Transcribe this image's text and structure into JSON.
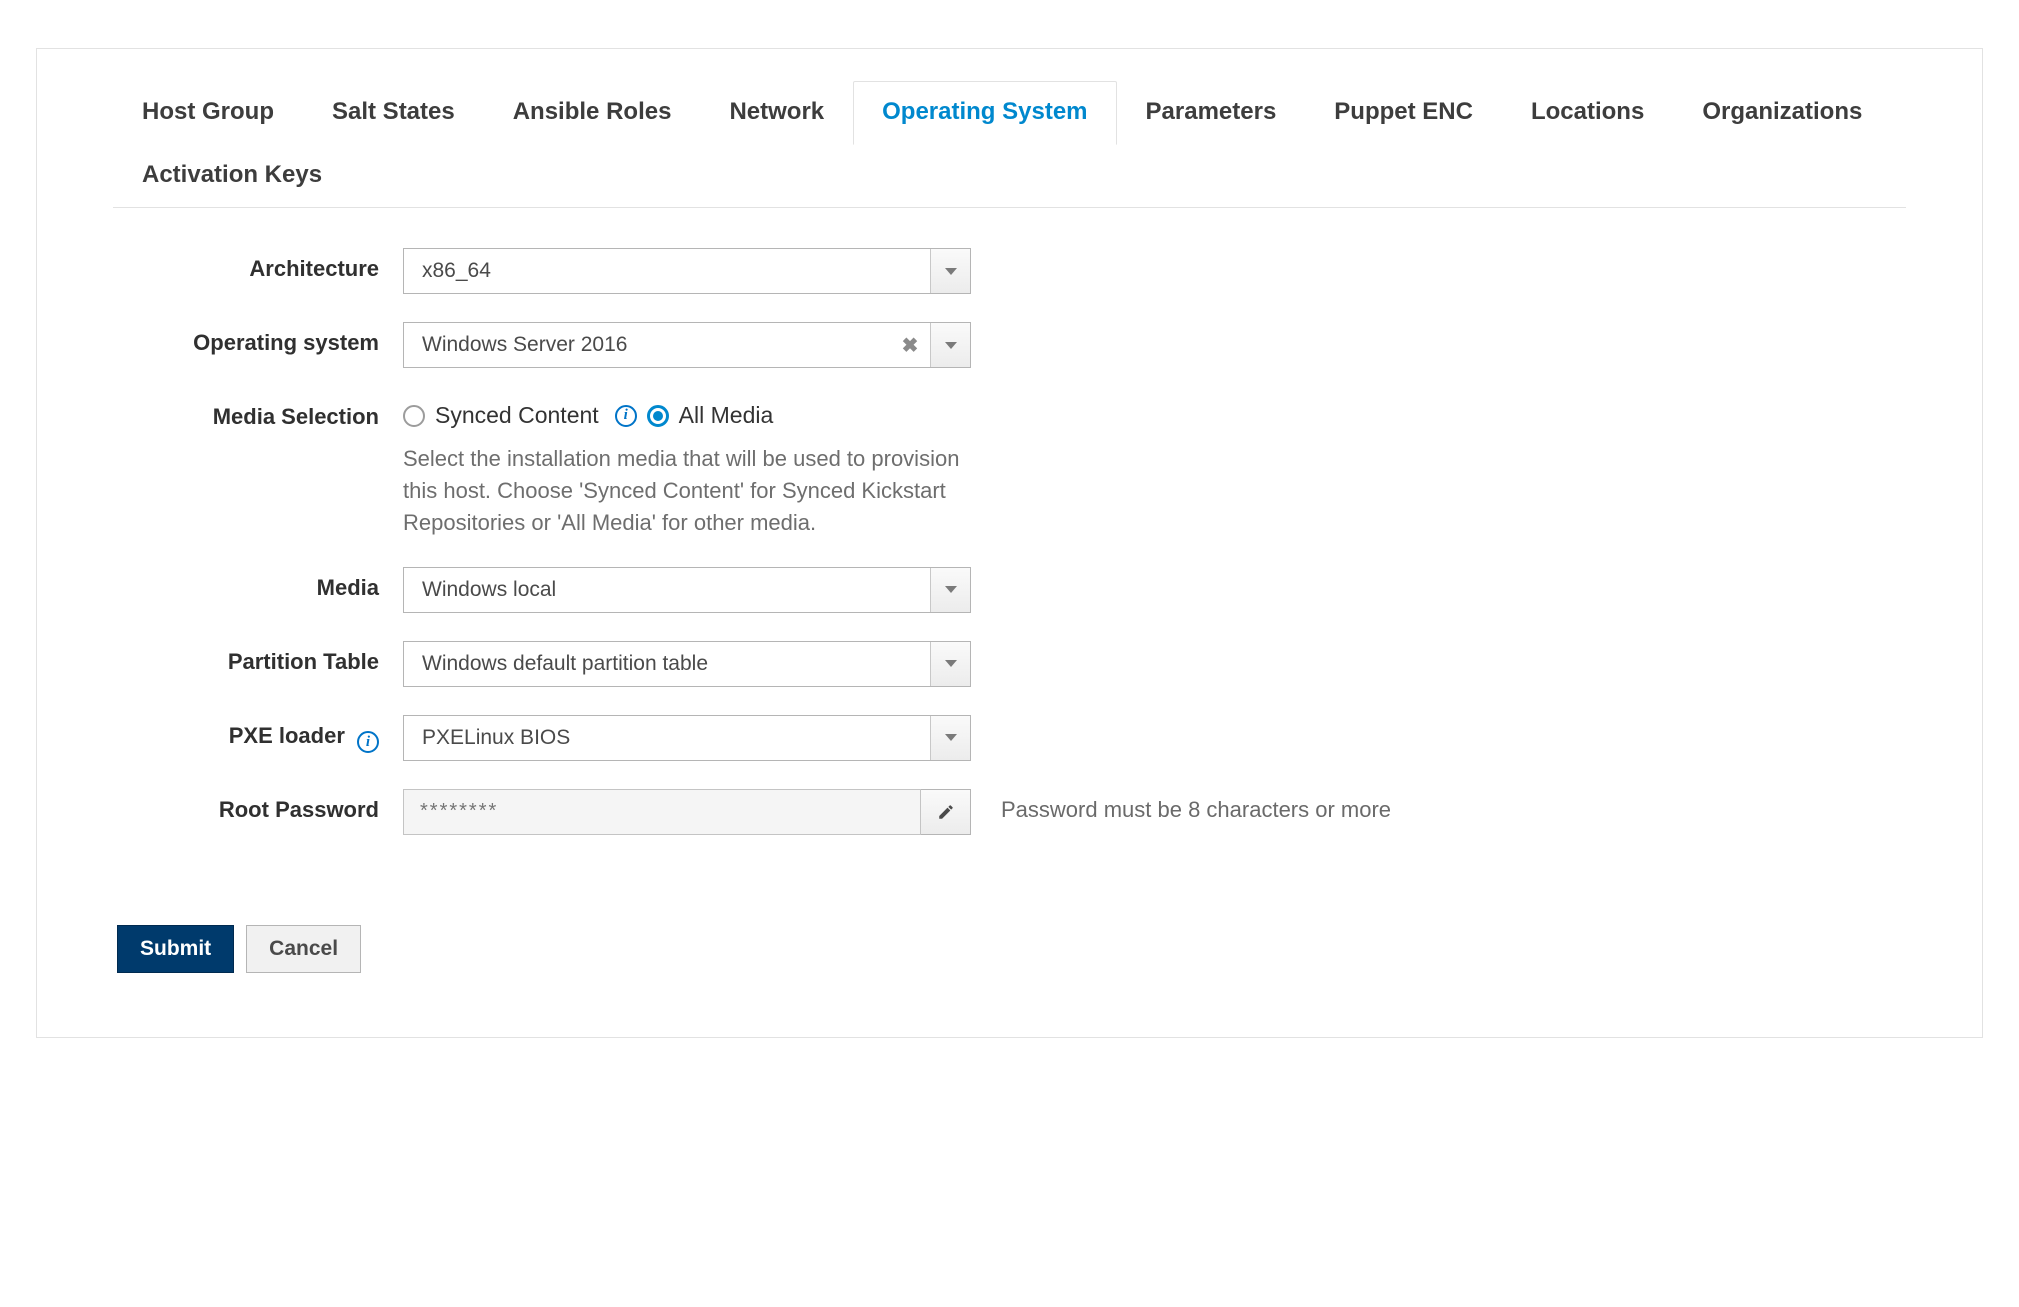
{
  "tabs": {
    "host_group": "Host Group",
    "salt_states": "Salt States",
    "ansible_roles": "Ansible Roles",
    "network": "Network",
    "operating_system": "Operating System",
    "parameters": "Parameters",
    "puppet_enc": "Puppet ENC",
    "locations": "Locations",
    "organizations": "Organizations",
    "activation_keys": "Activation Keys"
  },
  "labels": {
    "architecture": "Architecture",
    "operating_system": "Operating system",
    "media_selection": "Media Selection",
    "media": "Media",
    "partition_table": "Partition Table",
    "pxe_loader": "PXE loader",
    "root_password": "Root Password"
  },
  "values": {
    "architecture": "x86_64",
    "operating_system": "Windows Server 2016",
    "media": "Windows local",
    "partition_table": "Windows default partition table",
    "pxe_loader": "PXELinux BIOS",
    "root_password_placeholder": "********"
  },
  "media_selection": {
    "synced_content": "Synced Content",
    "all_media": "All Media",
    "help": "Select the installation media that will be used to provision this host. Choose 'Synced Content' for Synced Kickstart Repositories or 'All Media' for other media."
  },
  "root_password_hint": "Password must be 8 characters or more",
  "buttons": {
    "submit": "Submit",
    "cancel": "Cancel"
  }
}
